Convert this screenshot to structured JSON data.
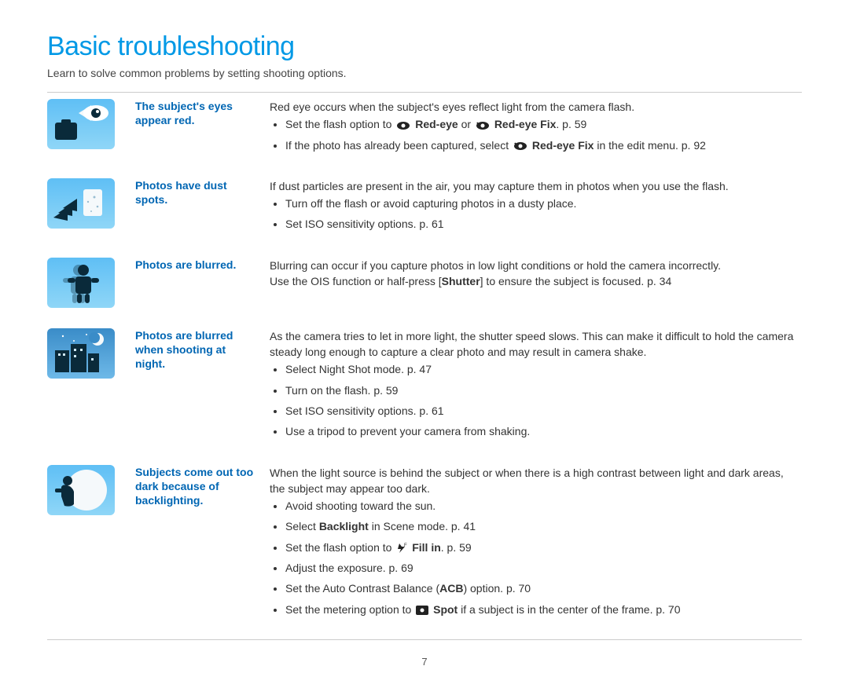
{
  "title": "Basic troubleshooting",
  "intro": "Learn to solve common problems by setting shooting options.",
  "page_number": "7",
  "items": [
    {
      "topic": "The subject's eyes appear red.",
      "lead": "Red eye occurs when the subject's eyes reflect light from the camera flash.",
      "bullets": [
        {
          "pre": "Set the flash option to ",
          "icon1": "eye",
          "bold1": "Red-eye",
          "mid": " or ",
          "icon2": "eye-fix",
          "bold2": "Red-eye Fix",
          "post": ". p. 59"
        },
        {
          "pre": "If the photo has already been captured, select ",
          "icon1": "eye-fix",
          "bold1": "Red-eye Fix",
          "post": " in the edit menu. p. 92"
        }
      ]
    },
    {
      "topic": "Photos have dust spots.",
      "lead": "If dust particles are present in the air, you may capture them in photos when you use the flash.",
      "bullets": [
        {
          "text": "Turn off the flash or avoid capturing photos in a dusty place."
        },
        {
          "text": "Set ISO sensitivity options. p. 61"
        }
      ]
    },
    {
      "topic": "Photos are blurred.",
      "lead_pre": "Blurring can occur if you capture photos in low light conditions or hold the camera incorrectly.\nUse the OIS function or half-press [",
      "lead_bold": "Shutter",
      "lead_post": "] to ensure the subject is focused. p. 34"
    },
    {
      "topic": "Photos are blurred when shooting at night.",
      "lead": "As the camera tries to let in more light, the shutter speed slows. This can make it difficult to hold the camera steady long enough to capture a clear photo and may result in camera shake.",
      "bullets": [
        {
          "text": "Select Night Shot mode. p. 47"
        },
        {
          "text": "Turn on the flash. p. 59"
        },
        {
          "text": "Set ISO sensitivity options. p. 61"
        },
        {
          "text": "Use a tripod to prevent your camera from shaking."
        }
      ]
    },
    {
      "topic": "Subjects come out too dark because of backlighting.",
      "lead": "When the light source is behind the subject or when there is a high contrast between light and dark areas, the subject may appear too dark.",
      "bullets": [
        {
          "text": "Avoid shooting toward the sun."
        },
        {
          "pre": "Select ",
          "bold1": "Backlight",
          "post": " in Scene mode. p. 41"
        },
        {
          "pre": "Set the flash option to ",
          "icon1": "fill-in",
          "bold1": "Fill in",
          "post": ". p. 59"
        },
        {
          "text": "Adjust the exposure. p. 69"
        },
        {
          "pre": "Set the Auto Contrast Balance (",
          "bold1": "ACB",
          "post": ") option. p. 70"
        },
        {
          "pre": "Set the metering option to ",
          "icon1": "spot",
          "bold1": "Spot",
          "post": " if a subject is in the center of the frame. p. 70"
        }
      ]
    }
  ]
}
